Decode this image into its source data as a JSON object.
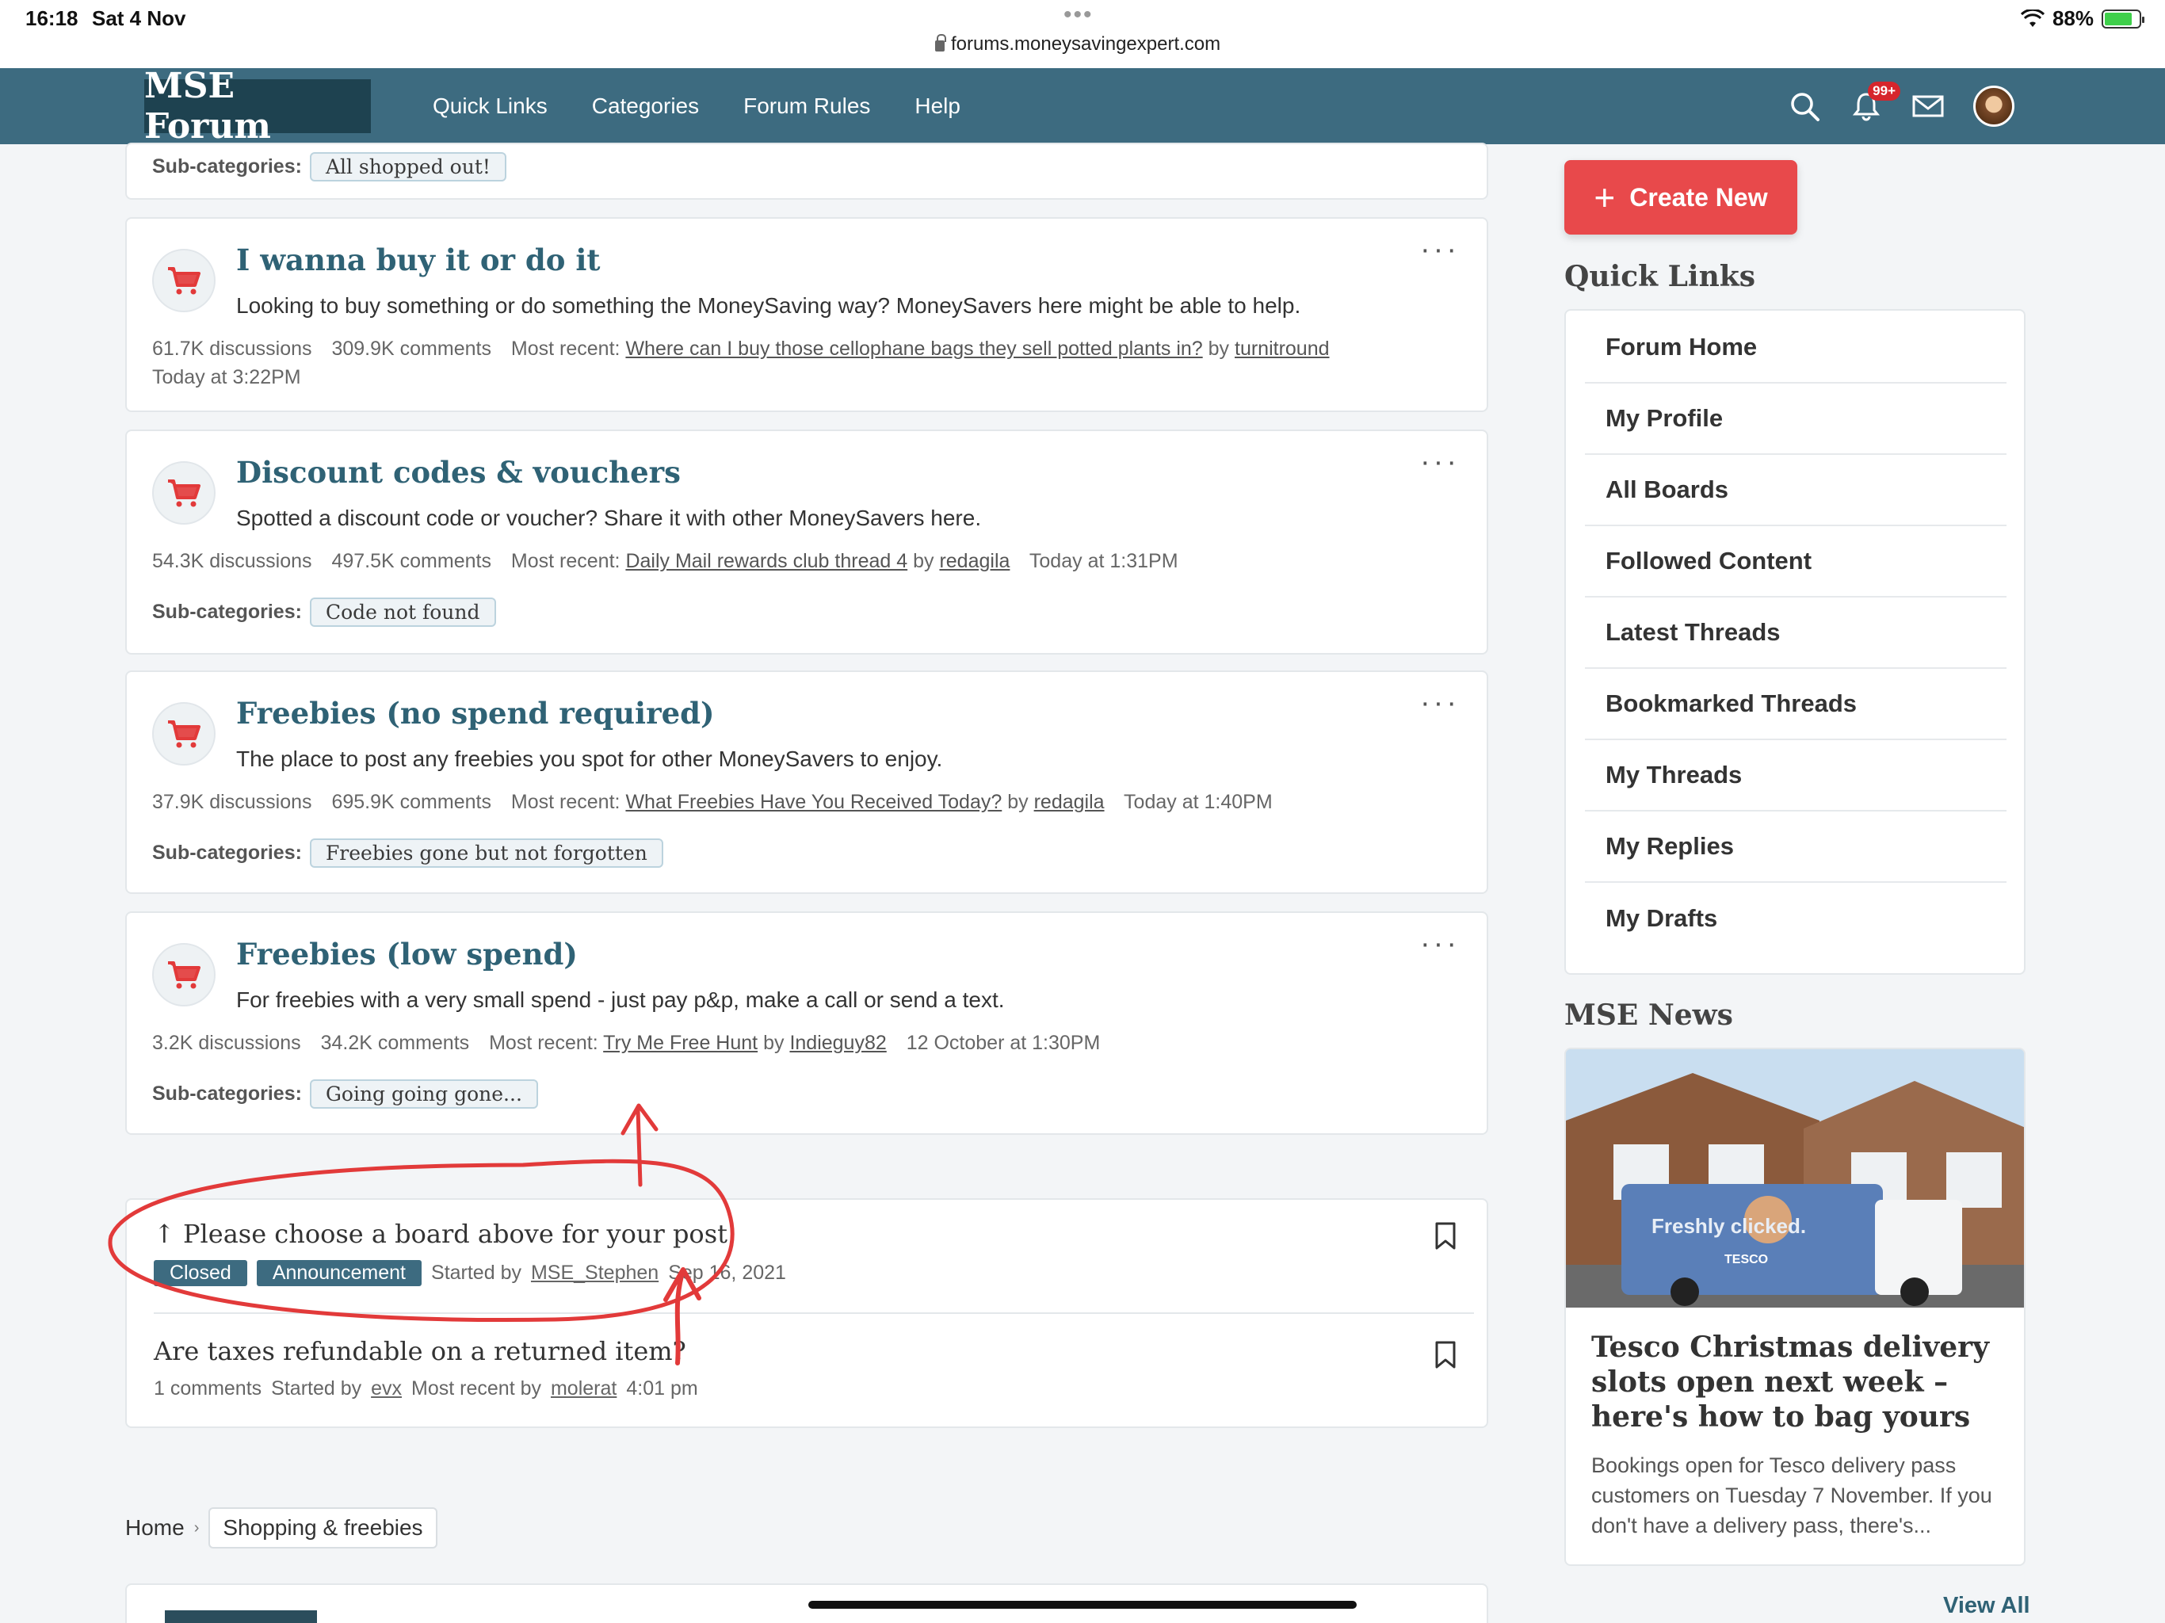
{
  "status_bar": {
    "time": "16:18",
    "date": "Sat 4 Nov",
    "url": "forums.moneysavingexpert.com",
    "battery": "88%"
  },
  "nav": {
    "logo": "MSE Forum",
    "links": [
      "Quick Links",
      "Categories",
      "Forum Rules",
      "Help"
    ],
    "notification_count": "99+"
  },
  "top_subcat": {
    "label": "Sub-categories:",
    "chip": "All shopped out!"
  },
  "categories": [
    {
      "title": "I wanna buy it or do it",
      "description": "Looking to buy something or do something the MoneySaving way? MoneySavers here might be able to help.",
      "discussions": "61.7K discussions",
      "comments": "309.9K comments",
      "recent_label": "Most recent:",
      "recent_thread": "Where can I buy those cellophane bags they sell potted plants in?",
      "by": "by",
      "recent_user": "turnitround",
      "recent_time": "Today at 3:22PM"
    },
    {
      "title": "Discount codes & vouchers",
      "description": "Spotted a discount code or voucher? Share it with other MoneySavers here.",
      "discussions": "54.3K discussions",
      "comments": "497.5K comments",
      "recent_label": "Most recent:",
      "recent_thread": "Daily Mail rewards club thread 4",
      "by": "by",
      "recent_user": "redagila",
      "recent_time": "Today at 1:31PM",
      "subcat_label": "Sub-categories:",
      "subcat": "Code not found"
    },
    {
      "title": "Freebies (no spend required)",
      "description": "The place to post any freebies you spot for other MoneySavers to enjoy.",
      "discussions": "37.9K discussions",
      "comments": "695.9K comments",
      "recent_label": "Most recent:",
      "recent_thread": "What Freebies Have You Received Today?",
      "by": "by",
      "recent_user": "redagila",
      "recent_time": "Today at 1:40PM",
      "subcat_label": "Sub-categories:",
      "subcat": "Freebies gone but not forgotten"
    },
    {
      "title": "Freebies (low spend)",
      "description": "For freebies with a very small spend - just pay p&p, make a call or send a text.",
      "discussions": "3.2K discussions",
      "comments": "34.2K comments",
      "recent_label": "Most recent:",
      "recent_thread": "Try Me Free Hunt",
      "by": "by",
      "recent_user": "Indieguy82",
      "recent_time": "12 October at 1:30PM",
      "subcat_label": "Sub-categories:",
      "subcat": "Going going gone..."
    }
  ],
  "threads": [
    {
      "title": "↑ Please choose a board above for your post",
      "tag1": "Closed",
      "tag2": "Announcement",
      "started_by": "Started by",
      "user": "MSE_Stephen",
      "date": "Sep 16, 2021"
    },
    {
      "title": "Are taxes refundable on a returned item?",
      "comments": "1 comments",
      "started_by": "Started by",
      "user": "evx",
      "recent_by": "Most recent by",
      "recent_user": "molerat",
      "time": "4:01 pm"
    }
  ],
  "breadcrumb": {
    "home": "Home",
    "current": "Shopping & freebies"
  },
  "sidebar": {
    "create_new": "Create New",
    "quick_links_heading": "Quick Links",
    "quick_links": [
      "Forum Home",
      "My Profile",
      "All Boards",
      "Followed Content",
      "Latest Threads",
      "Bookmarked Threads",
      "My Threads",
      "My Replies",
      "My Drafts"
    ],
    "news_heading": "MSE News",
    "news_title": "Tesco Christmas delivery slots open next week – here's how to bag yours",
    "news_desc": "Bookings open for Tesco delivery pass customers on Tuesday 7 November. If you don't have a delivery pass, there's...",
    "news_img_text": "Freshly clicked.",
    "news_img_brand": "TESCO",
    "view_all": "View All"
  },
  "colors": {
    "nav": "#3d6b80",
    "accent": "#e8494b",
    "title": "#2f6275",
    "annotation": "#e23a3a"
  }
}
